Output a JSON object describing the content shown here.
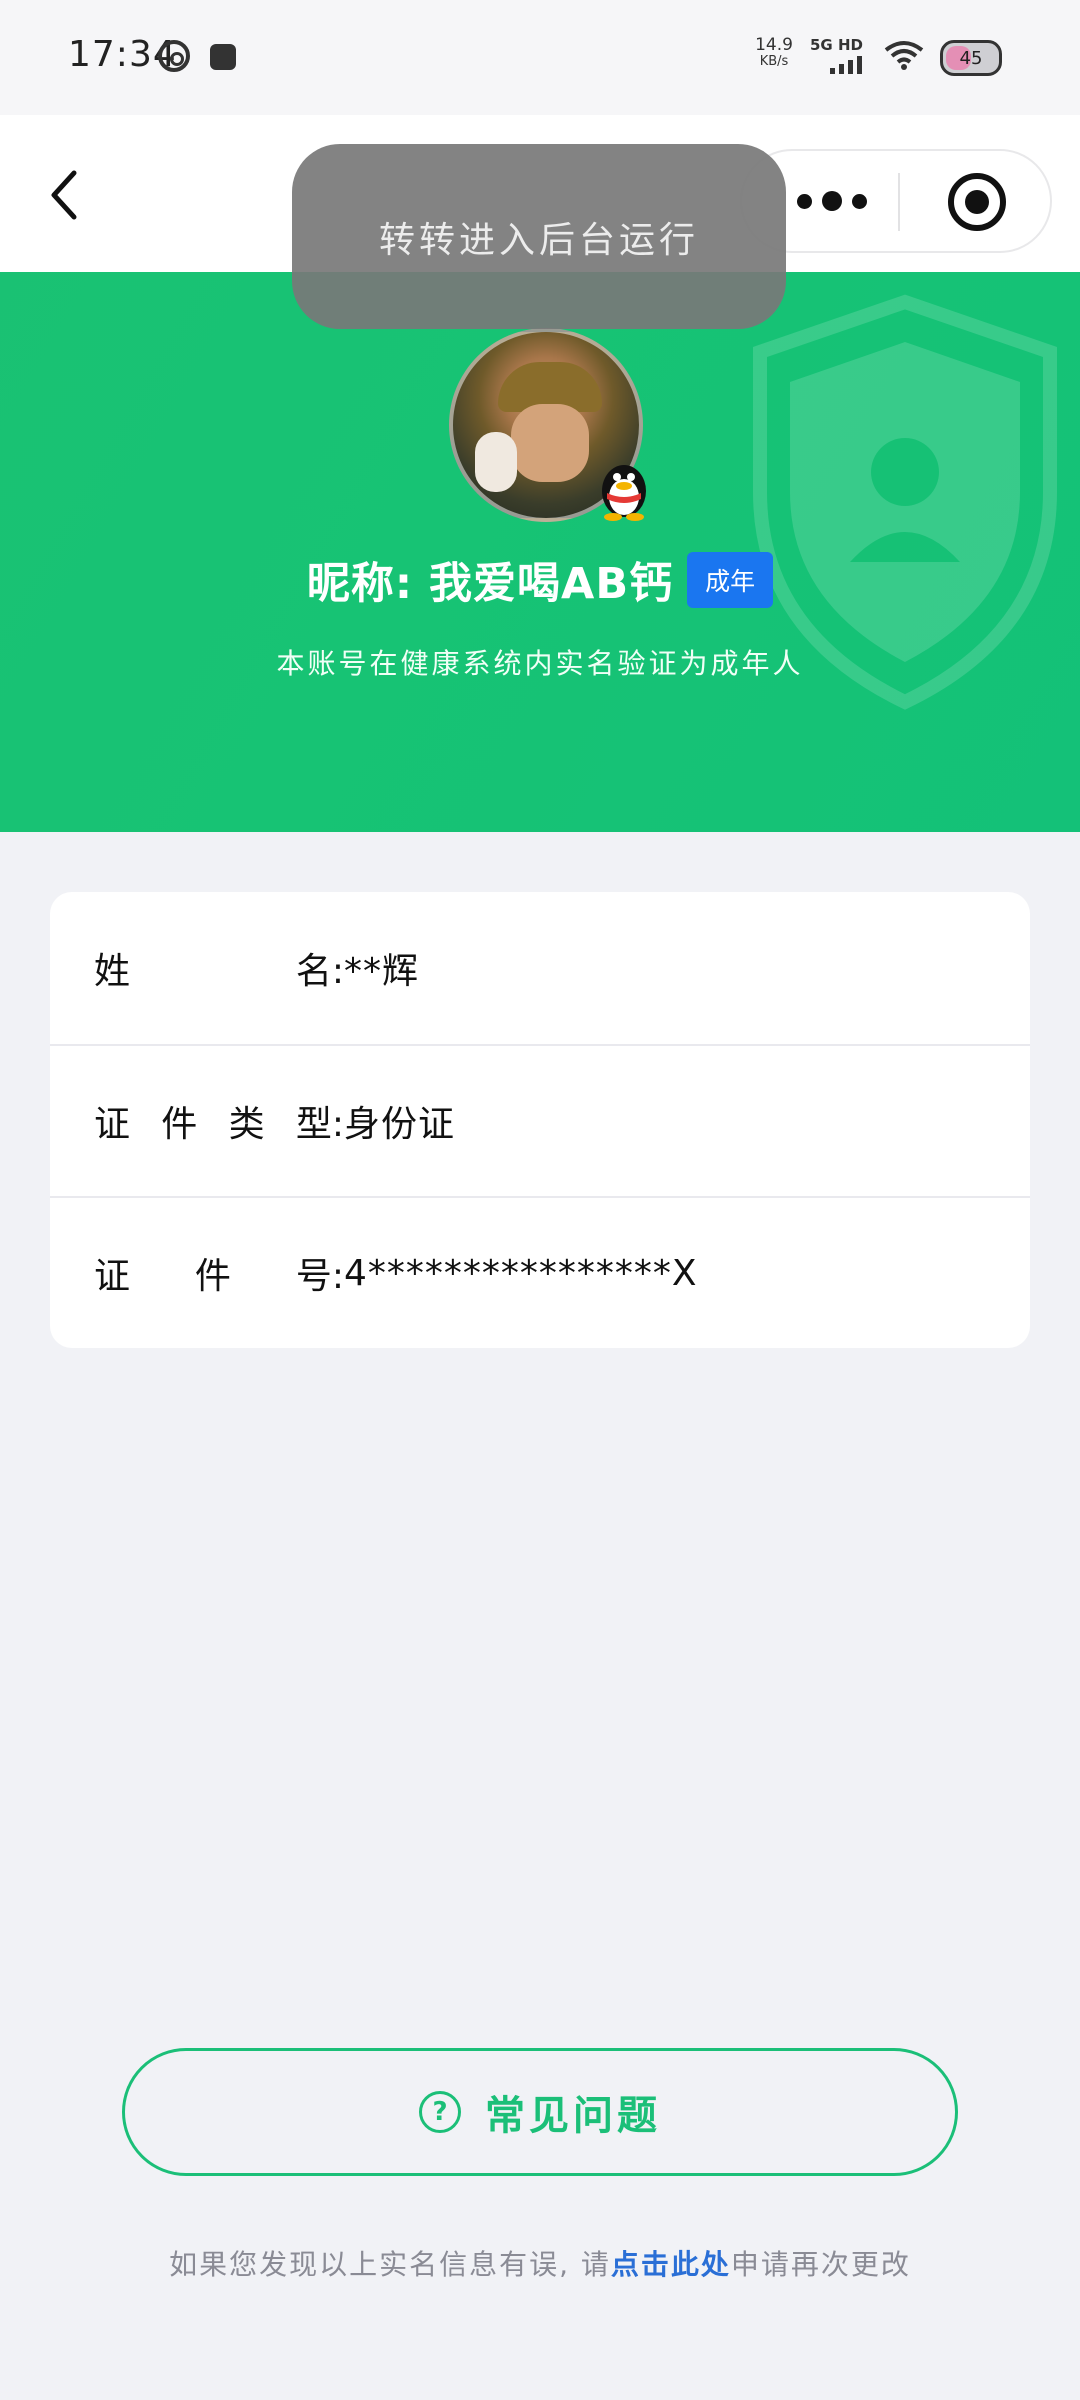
{
  "status_bar": {
    "time": "17:34",
    "net_speed_value": "14.9",
    "net_speed_unit": "KB/s",
    "network_type": "5G HD",
    "battery_level": "45",
    "battery_fraction": 0.45,
    "icons": [
      "circle-app-icon",
      "shield-app-icon",
      "signal-icon",
      "wifi-icon",
      "battery-icon"
    ]
  },
  "nav": {
    "back_icon": "chevron-left-icon",
    "more_icon": "more-dots-icon",
    "close_icon": "target-close-icon"
  },
  "toast": {
    "text": "转转进入后台运行"
  },
  "profile": {
    "nickname": "昵称: 我爱喝AB钙",
    "badge": "成年",
    "verify_note": "本账号在健康系统内实名验证为成年人",
    "avatar_badge_icon": "qq-penguin-icon"
  },
  "info": {
    "rows": [
      {
        "label_chars": [
          "姓",
          "名:"
        ],
        "value": "**辉"
      },
      {
        "label_chars": [
          "证",
          "件",
          "类",
          "型:"
        ],
        "value": "身份证"
      },
      {
        "label_chars": [
          "证",
          "件",
          "号:"
        ],
        "value": "4****************X"
      }
    ]
  },
  "faq": {
    "icon": "question-circle-icon",
    "label": "常见问题"
  },
  "footer": {
    "before": "如果您发现以上实名信息有误, 请",
    "link": "点击此处",
    "after": "申请再次更改"
  },
  "colors": {
    "brand_green": "#1bbf78",
    "badge_blue": "#1a76f0",
    "link_blue": "#2a6fd6",
    "page_bg": "#f1f2f6"
  }
}
